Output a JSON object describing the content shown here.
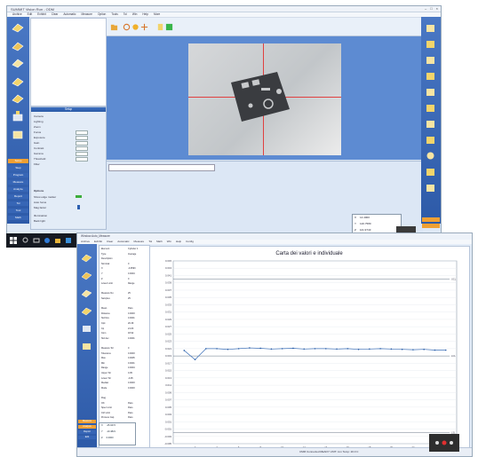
{
  "top_window": {
    "title": "SUMMIT Vision Run - ODM",
    "menu": [
      "Archive",
      "Edit",
      "Exhibit",
      "Clear",
      "Automatic",
      "Measure",
      "Option",
      "Tools",
      "Tol",
      "Win",
      "Help",
      "More"
    ],
    "left_panel_labels": [
      "Setup",
      "Step",
      "Program",
      "Measure",
      "Analyze",
      "Report",
      "Tol",
      "Tool",
      "Math"
    ],
    "panel_header": "Setup",
    "settings_rows": [
      "Camera",
      "Lighting",
      "Zoom",
      "Focus",
      "Exposure",
      "Gain",
      "Contrast",
      "Gamma",
      "Threshold",
      "Filter"
    ],
    "section_two": "Options",
    "option_rows": [
      "Show edge marker",
      "Auto focus",
      "Mag factor",
      "Illumination",
      "Back light"
    ],
    "coords": [
      {
        "axis": "X",
        "value": "14.4000"
      },
      {
        "axis": "Y",
        "value": "120.7580"
      },
      {
        "axis": "Z",
        "value": "121.9743"
      }
    ]
  },
  "bottom_window": {
    "title": "Window.Auto_Measure",
    "menu": [
      "Archive",
      "Exhibit",
      "Clear",
      "Automatic",
      "Measure",
      "Tol",
      "Math",
      "Win",
      "Help",
      "Config"
    ],
    "left_panel_labels": [
      "Measure",
      "Analysis",
      "Report",
      "Edit"
    ],
    "table_rows": [
      {
        "k": "Element",
        "v": "Cylinder 1"
      },
      {
        "k": "Type",
        "v": "Average"
      },
      {
        "k": "Description",
        "v": ""
      },
      {
        "k": "Nominal",
        "v": "0"
      },
      {
        "k": "X",
        "v": "-0.0593"
      },
      {
        "k": "Y",
        "v": "0.0004"
      },
      {
        "k": "Z",
        "v": "0"
      },
      {
        "k": "Lower Limit",
        "v": "Range"
      },
      {
        "k": "",
        "v": ""
      },
      {
        "k": "Measure No",
        "v": "25"
      },
      {
        "k": "Samples",
        "v": "25"
      },
      {
        "k": "",
        "v": ""
      },
      {
        "k": "Mean",
        "v": "Pass"
      },
      {
        "k": "Distance",
        "v": "0.0003"
      },
      {
        "k": "Std Dev",
        "v": "0.0001"
      },
      {
        "k": "Cpk",
        "v": "20.39"
      },
      {
        "k": "Cp",
        "v": "21.63"
      },
      {
        "k": "Cpm",
        "v": "18.92"
      },
      {
        "k": "Std dev",
        "v": "0.0001"
      },
      {
        "k": "",
        "v": ""
      },
      {
        "k": "Measure Tol",
        "v": "0"
      },
      {
        "k": "Tolerance",
        "v": "0.0003"
      },
      {
        "k": "Max",
        "v": "0.0005"
      },
      {
        "k": "Min",
        "v": "0.0001"
      },
      {
        "k": "Range",
        "v": "0.0004"
      },
      {
        "k": "Upper Tol",
        "v": "0.05"
      },
      {
        "k": "Lower Tol",
        "v": "-0.05"
      },
      {
        "k": "Median",
        "v": "0.0003"
      },
      {
        "k": "Mode",
        "v": "0.0003"
      },
      {
        "k": "",
        "v": ""
      },
      {
        "k": "Flag",
        "v": ""
      },
      {
        "k": "OK",
        "v": "Pass"
      },
      {
        "k": "Spec Limit",
        "v": "Pass"
      },
      {
        "k": "Ctrl Limit",
        "v": "Pass"
      },
      {
        "k": "Process Cap",
        "v": "Pass"
      }
    ],
    "coords": [
      {
        "axis": "X",
        "value": "-25.9472"
      },
      {
        "axis": "Y",
        "value": "-10.4821"
      },
      {
        "axis": "Z",
        "value": "0.0000"
      }
    ],
    "status_text": "CMM  Connected  READY  UNIT: mm  Temp: 20.0 C"
  },
  "chart_data": {
    "type": "line",
    "title": "Carta dei valori e individuale",
    "xlabel": "",
    "ylabel": "",
    "x": [
      1,
      2,
      3,
      4,
      5,
      6,
      7,
      8,
      9,
      10,
      11,
      12,
      13,
      14,
      15,
      16,
      17,
      18,
      19,
      20,
      21,
      22,
      23,
      24,
      25
    ],
    "ylim": [
      -0.005,
      0.045
    ],
    "yticks": [
      "0.045",
      "0.043",
      "0.041",
      "0.039",
      "0.037",
      "0.035",
      "0.033",
      "0.031",
      "0.029",
      "0.027",
      "0.025",
      "0.023",
      "0.021",
      "0.019",
      "0.017",
      "0.015",
      "0.013",
      "0.011",
      "0.009",
      "0.007",
      "0.005",
      "0.003",
      "0.001",
      "-0.001",
      "-0.003",
      "-0.005"
    ],
    "series": [
      {
        "name": "",
        "values": [
          0.0205,
          0.018,
          0.021,
          0.021,
          0.0208,
          0.021,
          0.0212,
          0.0211,
          0.0209,
          0.021,
          0.0211,
          0.0209,
          0.021,
          0.021,
          0.0209,
          0.021,
          0.0208,
          0.0209,
          0.021,
          0.0209,
          0.0208,
          0.0207,
          0.0208,
          0.0206,
          0.0206
        ]
      }
    ],
    "control_lines": [
      {
        "label": "UCL",
        "value": 0.04
      },
      {
        "label": "LCL",
        "value": 0.019
      },
      {
        "label": "LSL",
        "value": -0.002
      }
    ],
    "grid": true
  }
}
